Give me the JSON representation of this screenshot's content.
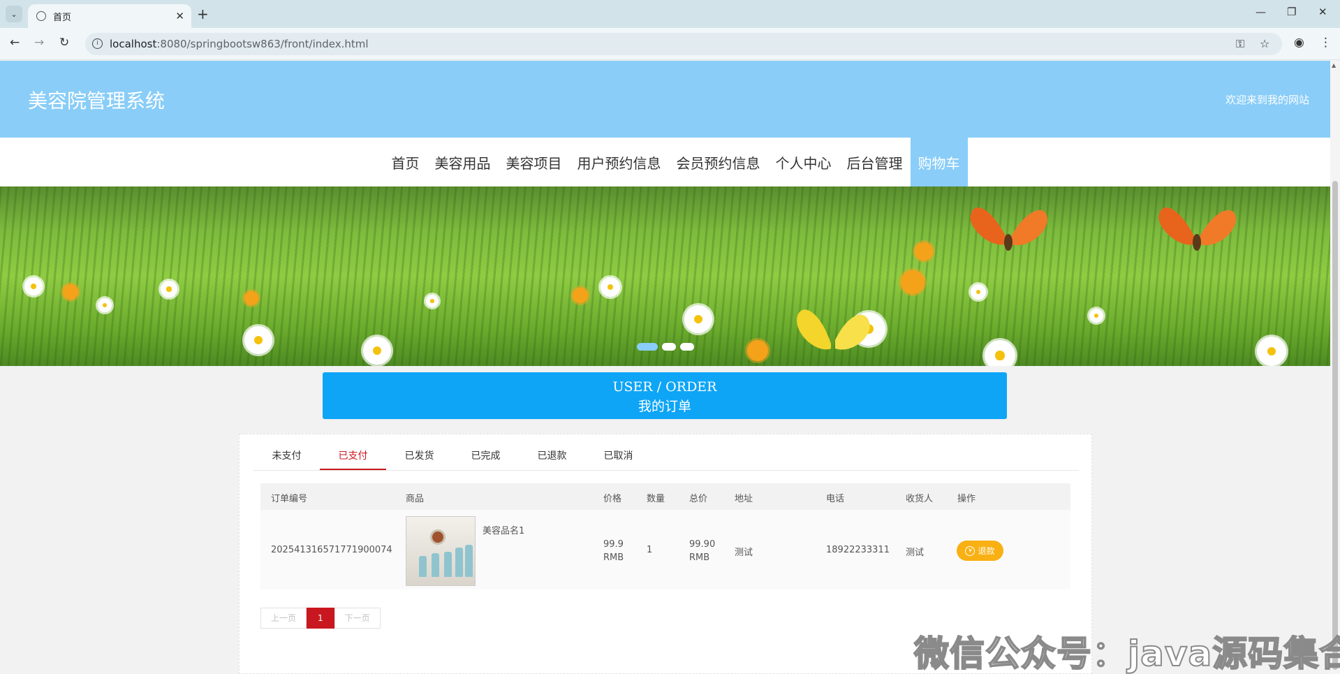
{
  "browser": {
    "tab_title": "首页",
    "url_host": "localhost",
    "url_path": ":8080/springbootsw863/front/index.html"
  },
  "site": {
    "title": "美容院管理系统",
    "welcome": "欢迎来到我的网站"
  },
  "nav": {
    "items": [
      "首页",
      "美容用品",
      "美容项目",
      "用户预约信息",
      "会员预约信息",
      "个人中心",
      "后台管理",
      "购物车"
    ],
    "active_index": 7
  },
  "banner": {
    "slides": 3,
    "active_slide": 1
  },
  "order_header": {
    "en": "USER / ORDER",
    "cn": "我的订单"
  },
  "order_tabs": {
    "items": [
      "未支付",
      "已支付",
      "已发货",
      "已完成",
      "已退款",
      "已取消"
    ],
    "active_index": 1
  },
  "table": {
    "headers": [
      "订单编号",
      "商品",
      "价格",
      "数量",
      "总价",
      "地址",
      "电话",
      "收货人",
      "操作"
    ],
    "rows": [
      {
        "order_no": "20254131657177190007​4",
        "product_name": "美容品名1",
        "price_value": "99.9",
        "price_unit": "RMB",
        "quantity": "1",
        "total_value": "99.90",
        "total_unit": "RMB",
        "address": "测试",
        "phone": "18922233311",
        "receiver": "测试",
        "action": "退款"
      }
    ]
  },
  "pager": {
    "prev": "上一页",
    "current": "1",
    "next": "下一页"
  },
  "watermark": "微信公众号：java源码集合",
  "colors": {
    "header_bg": "#89cdf8",
    "order_header_bg": "#0ea5f7",
    "active_tab": "#c9171f",
    "refund_button": "#f9b012"
  }
}
